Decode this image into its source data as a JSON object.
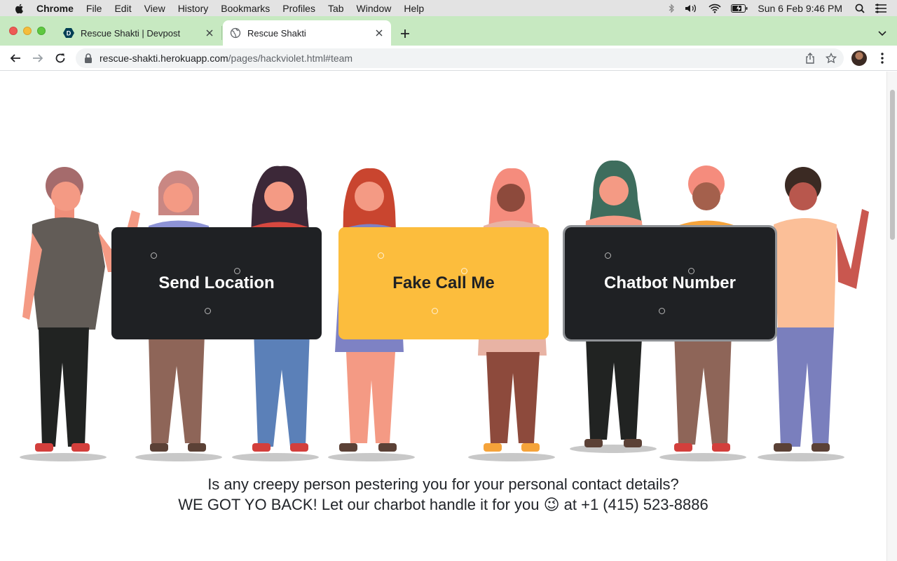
{
  "menubar": {
    "app": "Chrome",
    "items": [
      "File",
      "Edit",
      "View",
      "History",
      "Bookmarks",
      "Profiles",
      "Tab",
      "Window",
      "Help"
    ],
    "clock": "Sun 6 Feb  9:46 PM"
  },
  "tabs": [
    {
      "title": "Rescue Shakti | Devpost",
      "favicon": "devpost-icon",
      "active": false
    },
    {
      "title": "Rescue Shakti",
      "favicon": "globe-icon",
      "active": true
    }
  ],
  "omnibox": {
    "host": "rescue-shakti.herokuapp.com",
    "path": "/pages/hackviolet.html#team"
  },
  "actions": [
    {
      "label": "Send Location",
      "style": "dark"
    },
    {
      "label": "Fake Call Me",
      "style": "yellow"
    },
    {
      "label": "Chatbot Number",
      "style": "dark"
    }
  ],
  "tagline": {
    "line1": "Is any creepy person pestering you for your personal contact details?",
    "line2": "WE GOT YO BACK! Let our charbot handle it for you 😉 at +1 (415) 523-8886"
  },
  "colors": {
    "tabstrip": "#c7e9c1",
    "card_dark": "#1f2124",
    "card_yellow": "#fcbd3d"
  }
}
